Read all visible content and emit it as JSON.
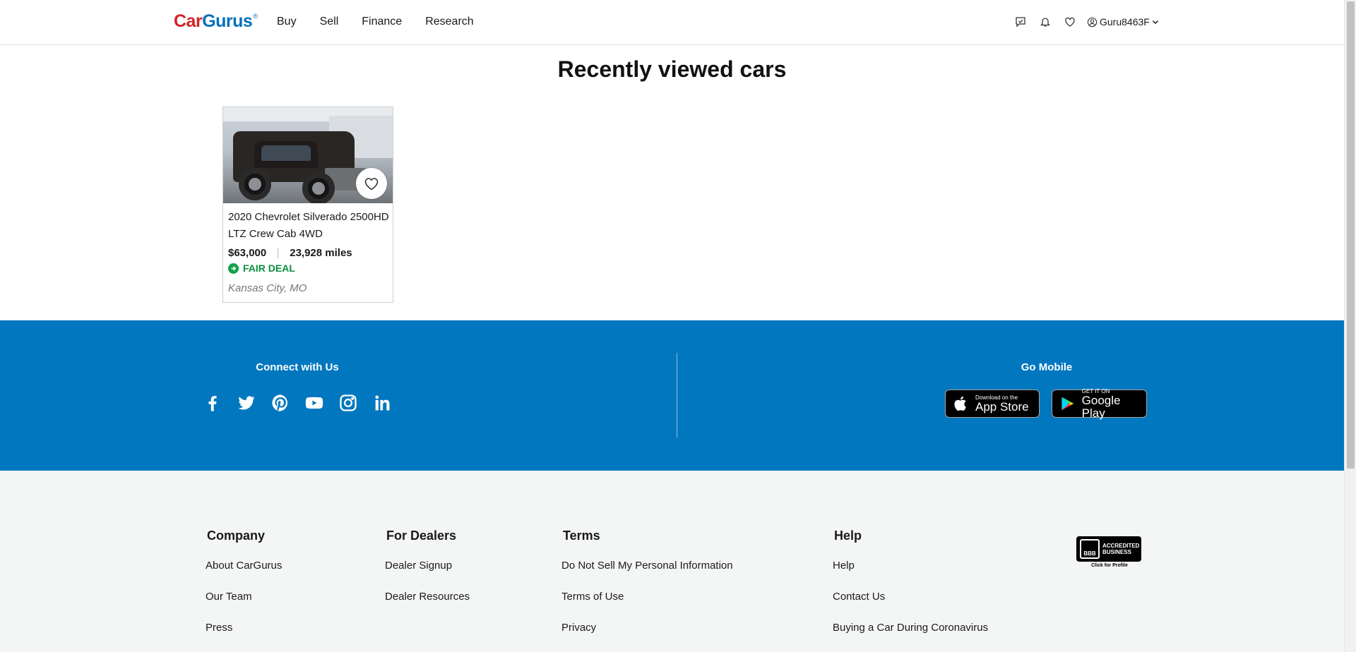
{
  "header": {
    "logo_car": "Car",
    "logo_gurus": "Gurus",
    "logo_reg": "®",
    "nav": [
      "Buy",
      "Sell",
      "Finance",
      "Research"
    ],
    "username": "Guru8463F"
  },
  "main": {
    "title": "Recently viewed cars",
    "cards": [
      {
        "title": "2020 Chevrolet Silverado 2500HD LTZ Crew Cab 4WD",
        "price": "$63,000",
        "mileage": "23,928 miles",
        "deal": "FAIR DEAL",
        "location": "Kansas City, MO"
      }
    ]
  },
  "blue_footer": {
    "connect_title": "Connect with Us",
    "socials": [
      "facebook-icon",
      "twitter-icon",
      "pinterest-icon",
      "youtube-icon",
      "instagram-icon",
      "linkedin-icon"
    ],
    "mobile_title": "Go Mobile",
    "app_store_small": "Download on the",
    "app_store_big": "App Store",
    "google_play_small": "GET IT ON",
    "google_play_big": "Google Play"
  },
  "gray_footer": {
    "company": {
      "heading": "Company",
      "links": [
        "About CarGurus",
        "Our Team",
        "Press"
      ]
    },
    "dealers": {
      "heading": "For Dealers",
      "links": [
        "Dealer Signup",
        "Dealer Resources"
      ]
    },
    "terms": {
      "heading": "Terms",
      "links": [
        "Do Not Sell My Personal Information",
        "Terms of Use",
        "Privacy"
      ]
    },
    "help": {
      "heading": "Help",
      "links": [
        "Help",
        "Contact Us",
        "Buying a Car During Coronavirus"
      ]
    },
    "bbb_seal": "BBB",
    "bbb_accredited_1": "ACCREDITED",
    "bbb_accredited_2": "BUSINESS",
    "bbb_click": "Click for Profile"
  },
  "colors": {
    "brand_red": "#d2232a",
    "brand_blue": "#0077be",
    "deal_green": "#0b8f3f"
  }
}
